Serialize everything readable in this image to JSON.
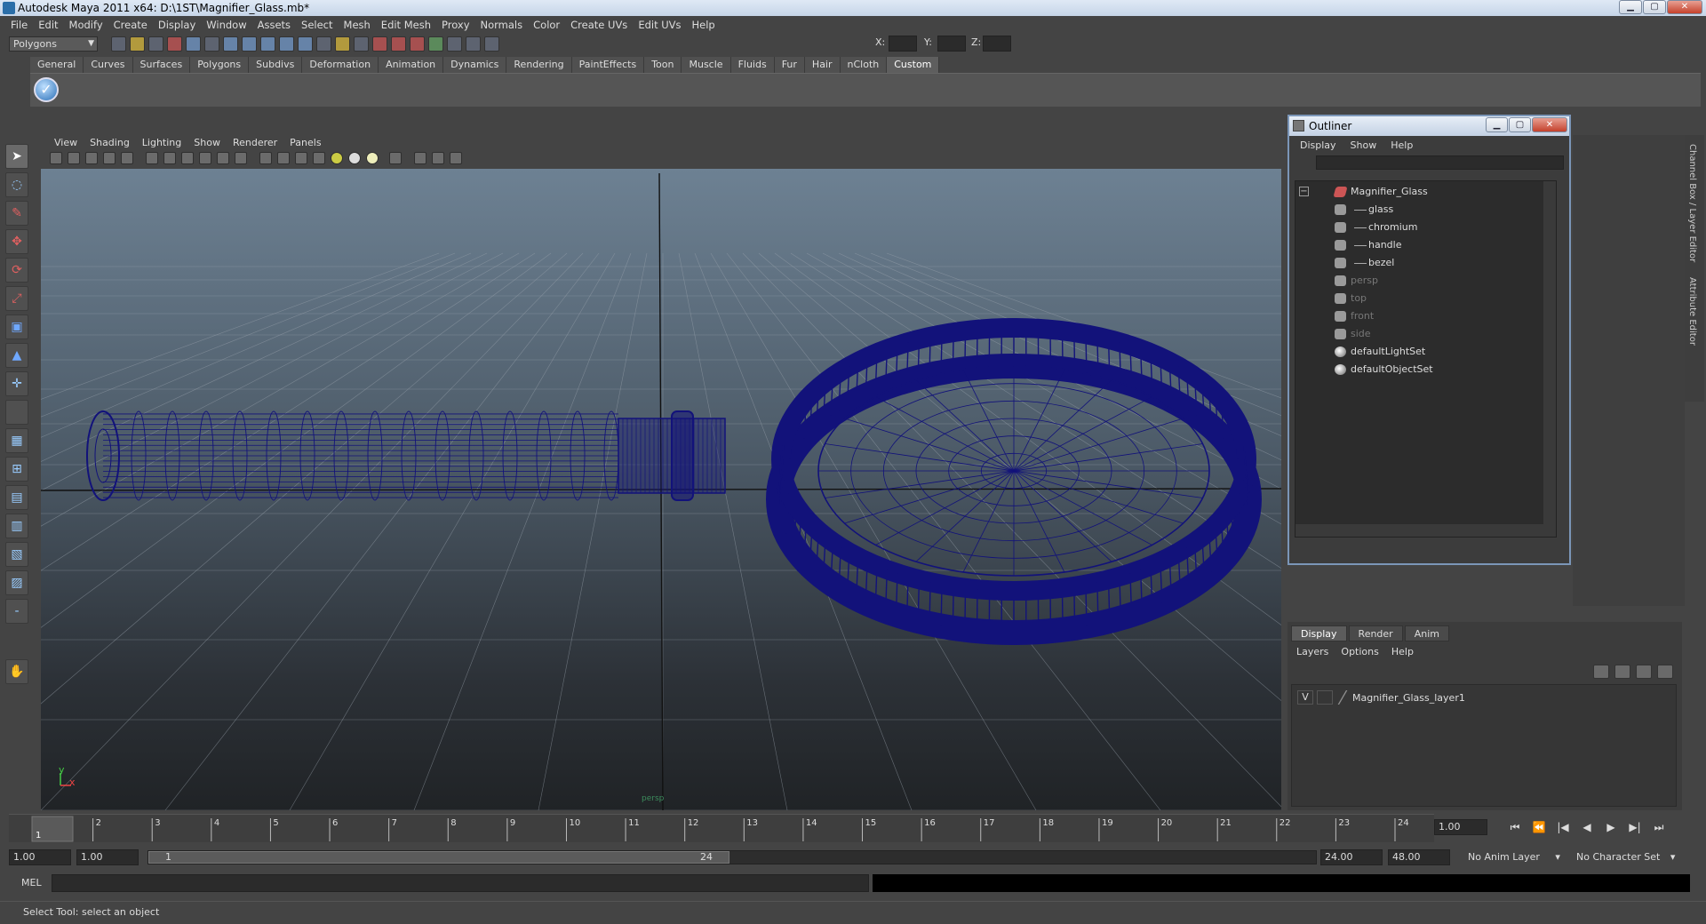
{
  "window": {
    "title": "Autodesk Maya 2011 x64: D:\\1ST\\Magnifier_Glass.mb*"
  },
  "menubar": [
    "File",
    "Edit",
    "Modify",
    "Create",
    "Display",
    "Window",
    "Assets",
    "Select",
    "Mesh",
    "Edit Mesh",
    "Proxy",
    "Normals",
    "Color",
    "Create UVs",
    "Edit UVs",
    "Help"
  ],
  "statusline": {
    "mode": "Polygons",
    "x_label": "X:",
    "y_label": "Y:",
    "z_label": "Z:"
  },
  "shelf": {
    "tabs": [
      "General",
      "Curves",
      "Surfaces",
      "Polygons",
      "Subdivs",
      "Deformation",
      "Animation",
      "Dynamics",
      "Rendering",
      "PaintEffects",
      "Toon",
      "Muscle",
      "Fluids",
      "Fur",
      "Hair",
      "nCloth",
      "Custom"
    ],
    "active_tab": "Custom"
  },
  "viewport": {
    "menus": [
      "View",
      "Shading",
      "Lighting",
      "Show",
      "Renderer",
      "Panels"
    ],
    "camera_label": "persp",
    "axis_y": "y",
    "axis_x": "x",
    "wire_color": "#12127a"
  },
  "outliner": {
    "title": "Outliner",
    "menus": [
      "Display",
      "Show",
      "Help"
    ],
    "items": [
      {
        "label": "Magnifier_Glass",
        "kind": "root",
        "indent": 0,
        "dim": false
      },
      {
        "label": "glass",
        "kind": "mesh",
        "indent": 1,
        "dim": false
      },
      {
        "label": "chromium",
        "kind": "mesh",
        "indent": 1,
        "dim": false
      },
      {
        "label": "handle",
        "kind": "mesh",
        "indent": 1,
        "dim": false
      },
      {
        "label": "bezel",
        "kind": "mesh",
        "indent": 1,
        "dim": false
      },
      {
        "label": "persp",
        "kind": "camera",
        "indent": 0,
        "dim": true
      },
      {
        "label": "top",
        "kind": "camera",
        "indent": 0,
        "dim": true
      },
      {
        "label": "front",
        "kind": "camera",
        "indent": 0,
        "dim": true
      },
      {
        "label": "side",
        "kind": "camera",
        "indent": 0,
        "dim": true
      },
      {
        "label": "defaultLightSet",
        "kind": "set",
        "indent": 0,
        "dim": false
      },
      {
        "label": "defaultObjectSet",
        "kind": "set",
        "indent": 0,
        "dim": false
      }
    ]
  },
  "sidetabs": {
    "channel_box": "Channel Box / Layer Editor",
    "attribute_editor": "Attribute Editor"
  },
  "layer_editor": {
    "tabs": [
      "Display",
      "Render",
      "Anim"
    ],
    "active_tab": "Display",
    "menus": [
      "Layers",
      "Options",
      "Help"
    ],
    "layers": [
      {
        "visible": "V",
        "name": "Magnifier_Glass_layer1"
      }
    ]
  },
  "timeline": {
    "start": 1,
    "end": 24,
    "ticks": [
      "1",
      "2",
      "3",
      "4",
      "5",
      "6",
      "7",
      "8",
      "9",
      "10",
      "11",
      "12",
      "13",
      "14",
      "15",
      "16",
      "17",
      "18",
      "19",
      "20",
      "21",
      "22",
      "23",
      "24"
    ],
    "current_marker": "1",
    "current_frame": "1.00"
  },
  "playback": [
    "⏮",
    "⏪",
    "|◀",
    "◀",
    "▶",
    "▶|",
    "⏭"
  ],
  "range": {
    "start": "1.00",
    "inner_start": "1.00",
    "handle_start": "1",
    "handle_end": "24",
    "end": "24.00",
    "outer_end": "48.00",
    "anim_layer": "No Anim Layer",
    "character_set": "No Character Set"
  },
  "command": {
    "lang": "MEL"
  },
  "help_line": "Select Tool: select an object"
}
